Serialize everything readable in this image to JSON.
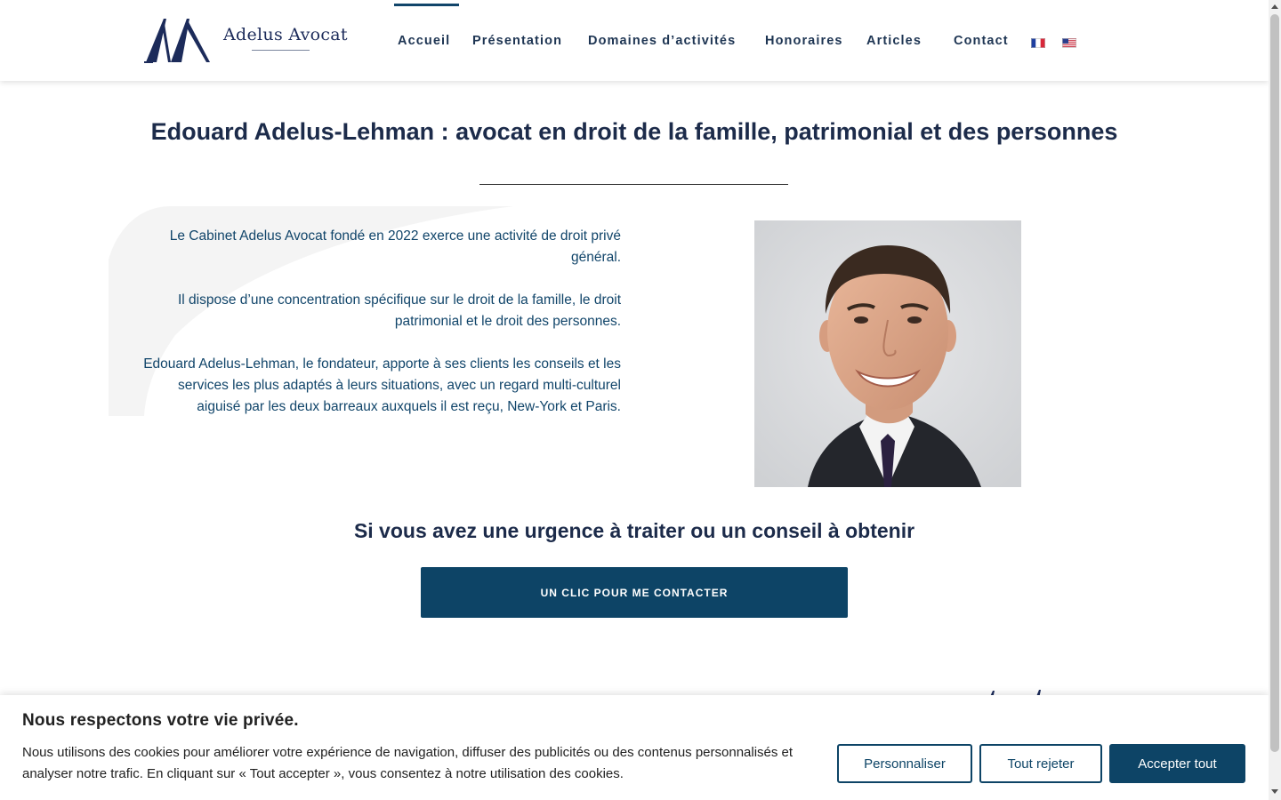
{
  "header": {
    "logo": {
      "text": "Adelus Avocat",
      "icon": "double-a-monogram-icon"
    },
    "nav": [
      {
        "label": "Accueil",
        "active": true
      },
      {
        "label": "Présentation"
      },
      {
        "label": "Domaines d’activités"
      },
      {
        "label": "Honoraires"
      },
      {
        "label": "Articles"
      },
      {
        "label": "Contact"
      }
    ],
    "languages": [
      {
        "icon": "flag-fr-icon",
        "code": "fr"
      },
      {
        "icon": "flag-us-icon",
        "code": "en"
      }
    ]
  },
  "main": {
    "title": "Edouard Adelus-Lehman : avocat en droit de la famille, patrimonial et des personnes",
    "paragraphs": [
      "Le Cabinet Adelus Avocat fondé en 2022 exerce une activité de droit privé général.",
      "Il dispose d’une concentration spécifique sur le droit de la famille, le droit patrimonial et le droit des personnes.",
      "Edouard Adelus-Lehman, le fondateur, apporte à ses clients les conseils et les services les plus adaptés à leurs situations, avec un regard multi-culturel aiguisé par les deux barreaux auxquels il est reçu, New-York et Paris."
    ],
    "cta_title": "Si vous avez une urgence à traiter ou un conseil à obtenir",
    "cta_button": "UN CLIC POUR ME CONTACTER"
  },
  "cookie_banner": {
    "title": "Nous respectons votre vie privée.",
    "text": "Nous utilisons des cookies pour améliorer votre expérience de navigation, diffuser des publicités ou des contenus personnalisés et analyser notre trafic. En cliquant sur « Tout accepter », vous consentez à notre utilisation des cookies.",
    "buttons": {
      "customize": "Personnaliser",
      "reject": "Tout rejeter",
      "accept": "Accepter tout"
    }
  },
  "colors": {
    "brand_dark": "#0d4466",
    "text_navy": "#1c2b4a",
    "paragraph_blue": "#11456a"
  }
}
